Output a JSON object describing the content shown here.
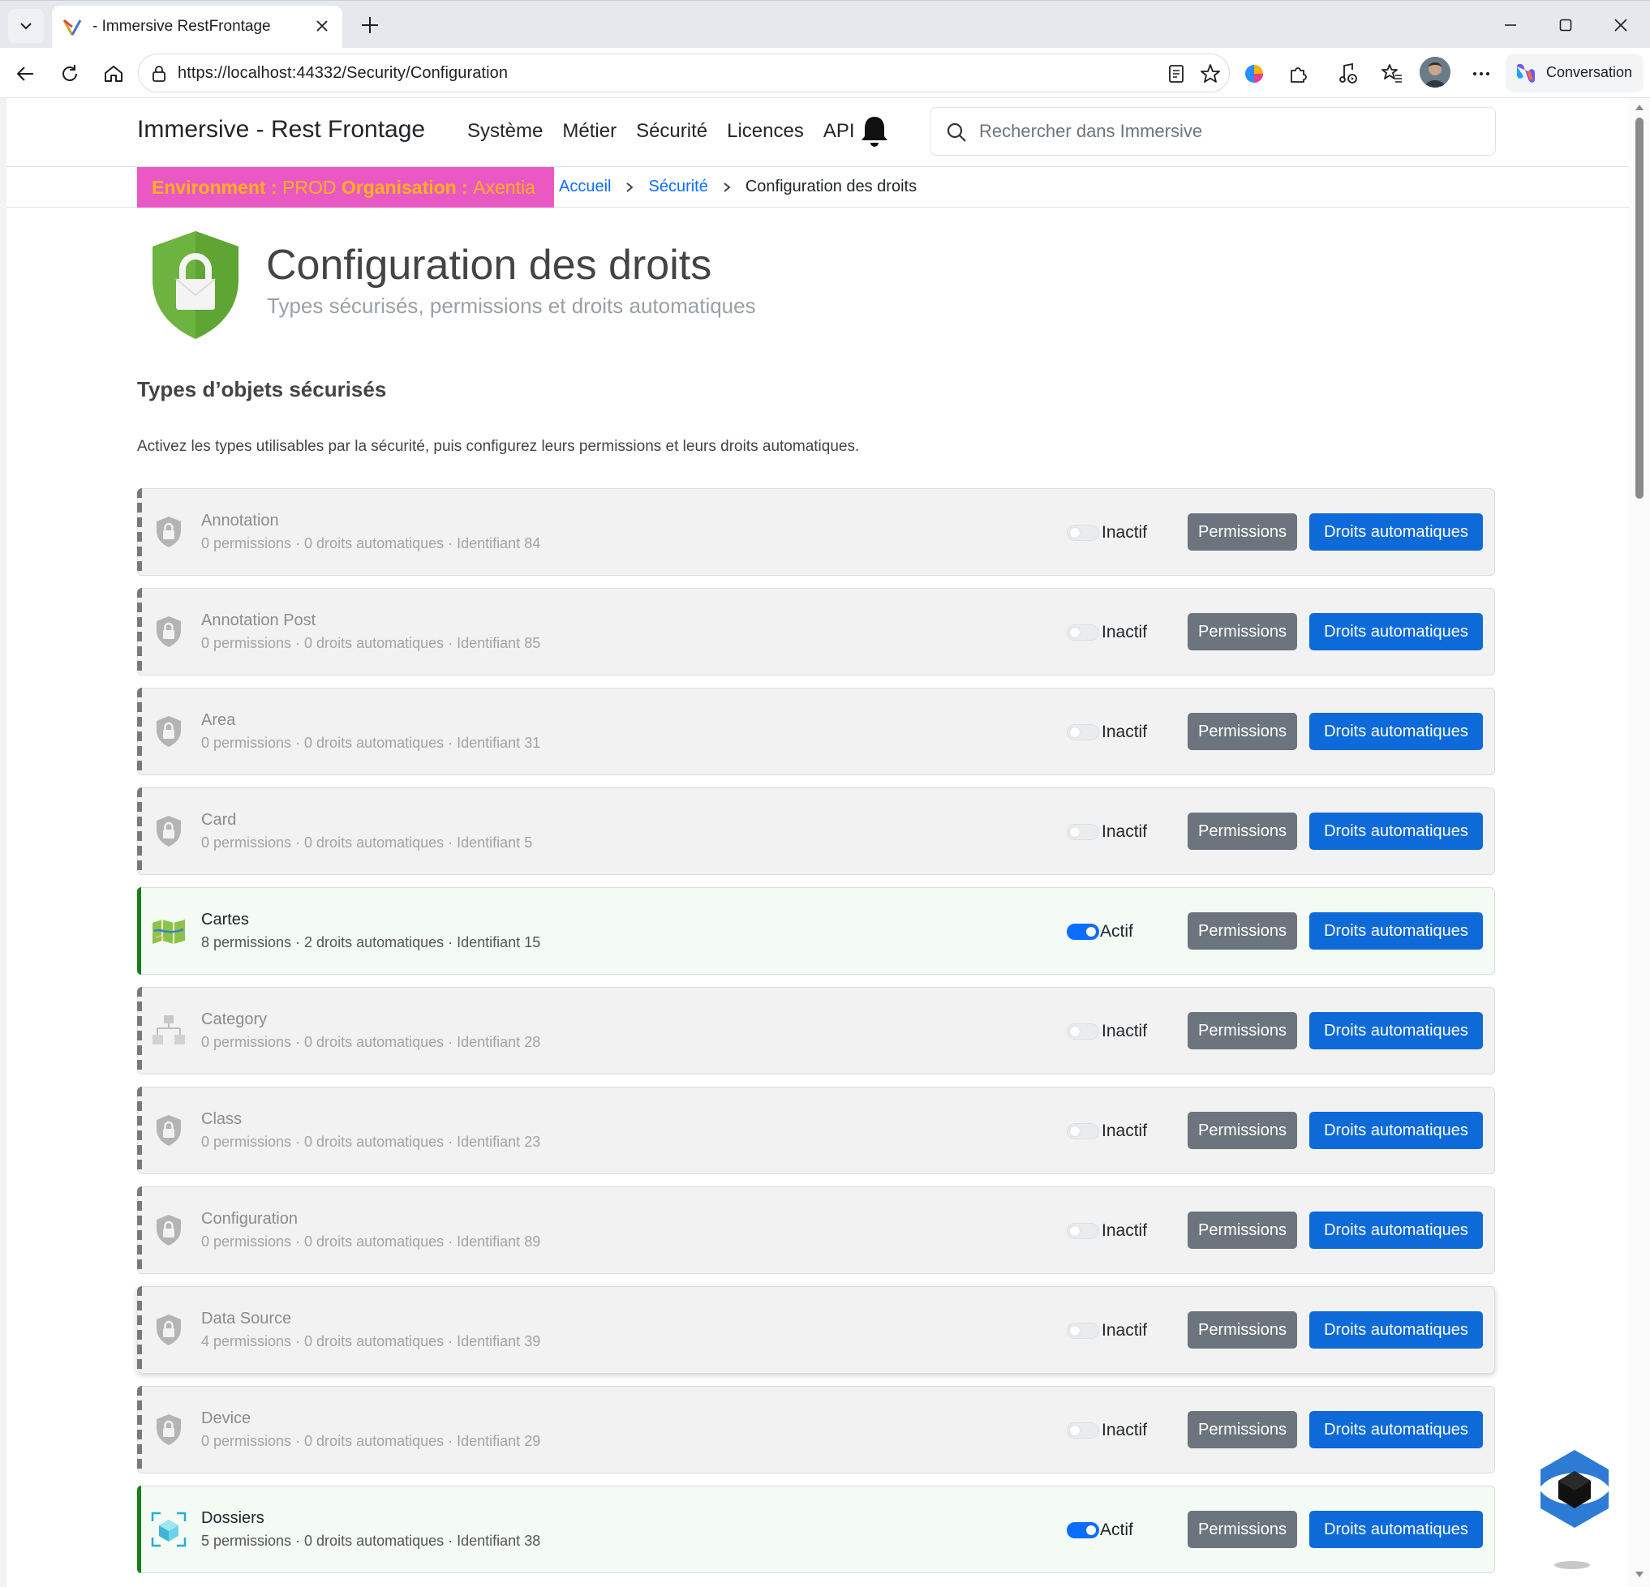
{
  "browser": {
    "tab_title": " - Immersive RestFrontage",
    "url_prefix": "https://",
    "url_host": "localhost",
    "url_rest": ":44332/Security/Configuration",
    "conversation_label": "Conversation"
  },
  "header": {
    "brand": "Immersive - Rest Frontage",
    "menu": [
      "Système",
      "Métier",
      "Sécurité",
      "Licences",
      "API"
    ],
    "search_placeholder": "Rechercher dans Immersive"
  },
  "env": {
    "environment_key": "Environment :",
    "environment_value": "PROD",
    "organisation_key": "Organisation :",
    "organisation_value": "Axentia"
  },
  "breadcrumb": {
    "home": "Accueil",
    "section": "Sécurité",
    "current": "Configuration des droits"
  },
  "page": {
    "title": "Configuration des droits",
    "subtitle": "Types sécurisés, permissions et droits automatiques",
    "section_title": "Types d’objets sécurisés",
    "section_desc": "Activez les types utilisables par la sécurité, puis configurez leurs permissions et leurs droits automatiques."
  },
  "labels": {
    "permissions_btn": "Permissions",
    "auto_rights_btn": "Droits automatiques",
    "active": "Actif",
    "inactive": "Inactif"
  },
  "types": [
    {
      "name": "Annotation",
      "meta": "0 permissions · 0 droits automatiques · Identifiant 84",
      "active": false,
      "icon": "shield-lock-icon"
    },
    {
      "name": "Annotation Post",
      "meta": "0 permissions · 0 droits automatiques · Identifiant 85",
      "active": false,
      "icon": "shield-lock-icon"
    },
    {
      "name": "Area",
      "meta": "0 permissions · 0 droits automatiques · Identifiant 31",
      "active": false,
      "icon": "shield-lock-icon"
    },
    {
      "name": "Card",
      "meta": "0 permissions · 0 droits automatiques · Identifiant 5",
      "active": false,
      "icon": "shield-lock-icon"
    },
    {
      "name": "Cartes",
      "meta": "8 permissions · 2 droits automatiques · Identifiant 15",
      "active": true,
      "icon": "map-icon"
    },
    {
      "name": "Category",
      "meta": "0 permissions · 0 droits automatiques · Identifiant 28",
      "active": false,
      "icon": "hierarchy-icon"
    },
    {
      "name": "Class",
      "meta": "0 permissions · 0 droits automatiques · Identifiant 23",
      "active": false,
      "icon": "shield-lock-icon"
    },
    {
      "name": "Configuration",
      "meta": "0 permissions · 0 droits automatiques · Identifiant 89",
      "active": false,
      "icon": "shield-lock-icon"
    },
    {
      "name": "Data Source",
      "meta": "4 permissions · 0 droits automatiques · Identifiant 39",
      "active": false,
      "icon": "shield-lock-icon"
    },
    {
      "name": "Device",
      "meta": "0 permissions · 0 droits automatiques · Identifiant 29",
      "active": false,
      "icon": "shield-lock-icon"
    },
    {
      "name": "Dossiers",
      "meta": "5 permissions · 0 droits automatiques · Identifiant 38",
      "active": true,
      "icon": "cube-scan-icon"
    }
  ],
  "colors": {
    "env_bg": "#e958c3",
    "env_text": "#ffb21a",
    "primary": "#0d6ad8",
    "secondary": "#6c757d",
    "active_border": "#1a7f1a",
    "shield_green": "#6cb33f"
  }
}
